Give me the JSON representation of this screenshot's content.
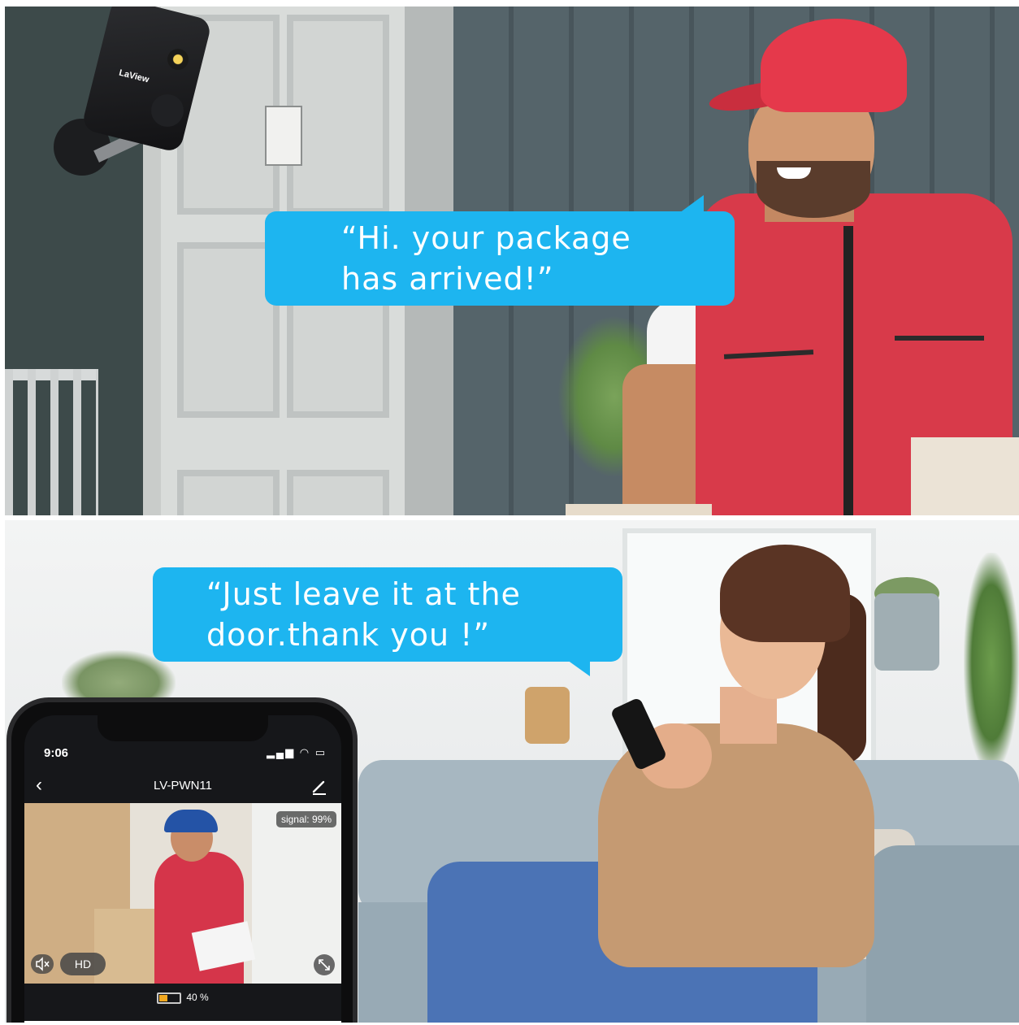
{
  "speech": {
    "delivery": [
      "“Hi. your package",
      "has arrived!”"
    ],
    "reply": [
      "“Just leave it at the",
      "door.thank you !”"
    ]
  },
  "camera": {
    "brand": "LaView"
  },
  "phone": {
    "time": "9:06",
    "status_icons": "▂▄▆ ◠ ▭",
    "back_glyph": "‹",
    "title": "LV-PWN11",
    "signal_label": "signal: 99%",
    "hd_label": "HD",
    "battery_text": "40 %",
    "battery_level": 0.4
  },
  "colors": {
    "bubble": "#1db5f0",
    "battery": "#f0a821"
  }
}
